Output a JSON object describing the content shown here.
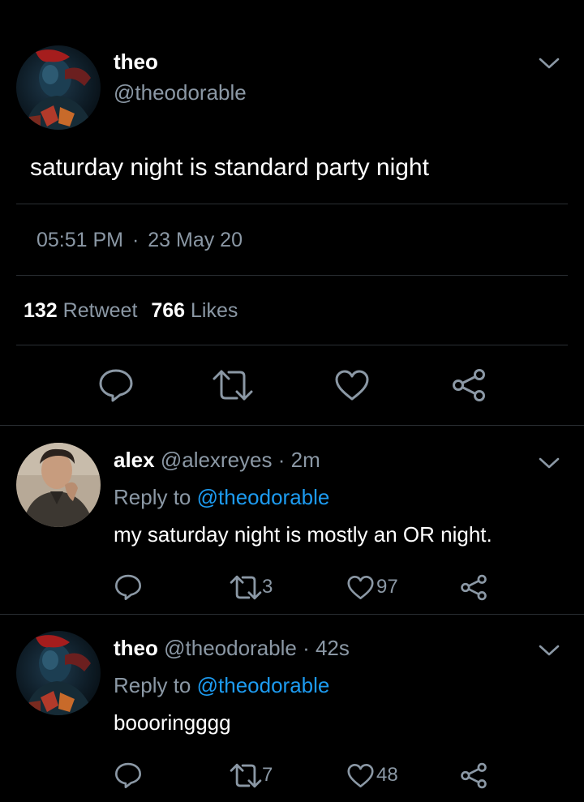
{
  "main_tweet": {
    "display_name": "theo",
    "handle": "@theodorable",
    "text": "saturday night is standard party night",
    "time": "05:51 PM",
    "separator": "·",
    "date": "23 May 20",
    "retweet_count": "132",
    "retweet_label": "Retweet",
    "likes_count": "766",
    "likes_label": "Likes",
    "actions": [
      "reply-icon",
      "retweet-icon",
      "like-icon",
      "share-icon"
    ]
  },
  "replies": [
    {
      "display_name": "alex",
      "handle": "@alexreyes",
      "time": "· 2m",
      "reply_to_label": "Reply to",
      "reply_to_handle": "@theodorable",
      "text": "my saturday night is mostly an OR night.",
      "retweets": "3",
      "likes": "97"
    },
    {
      "display_name": "theo",
      "handle": "@theodorable",
      "time": "· 42s",
      "reply_to_label": "Reply to",
      "reply_to_handle": "@theodorable",
      "text": "boooringggg",
      "retweets": "7",
      "likes": "48"
    }
  ],
  "colors": {
    "background": "#000000",
    "primary_text": "#e7e9ea",
    "secondary_text": "#8b98a5",
    "link": "#1d9bf0",
    "divider": "#2a2f33"
  }
}
